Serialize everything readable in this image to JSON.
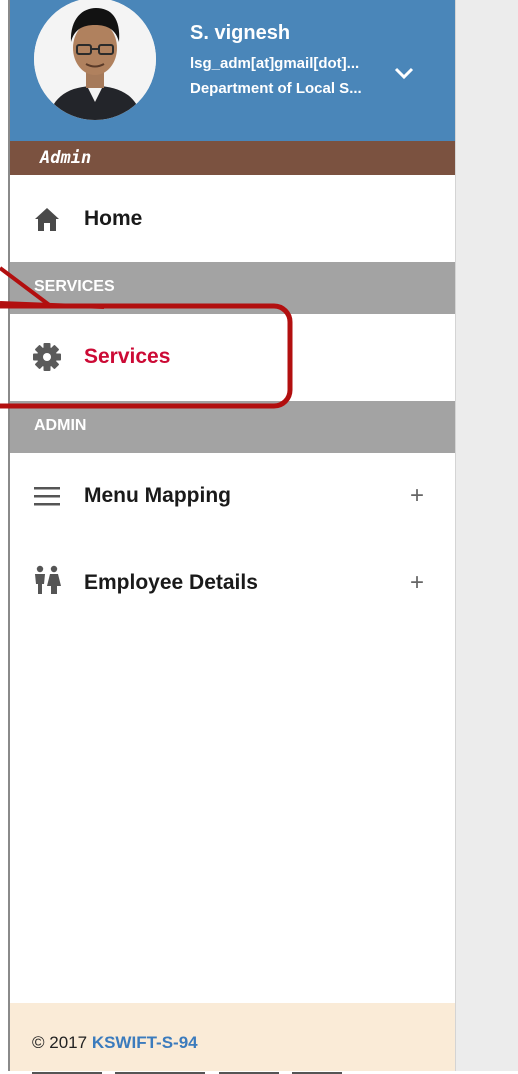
{
  "profile": {
    "name": "S. vignesh",
    "email": "lsg_adm[at]gmail[dot]...",
    "department": "Department of Local S...",
    "avatar_icon": "user-photo",
    "header_color": "#4a86b9"
  },
  "role": {
    "label": "Admin",
    "color": "#7b5240"
  },
  "menu": {
    "home": {
      "label": "Home",
      "icon": "home-icon"
    },
    "services_section": "SERVICES",
    "services": {
      "label": "Services",
      "icon": "gear-icon",
      "color": "#cc0a35"
    },
    "admin_section": "ADMIN",
    "menu_mapping": {
      "label": "Menu Mapping",
      "icon": "hamburger-icon",
      "expand": "+"
    },
    "employee_details": {
      "label": "Employee Details",
      "icon": "people-icon",
      "expand": "+"
    }
  },
  "footer": {
    "copyright": "© 2017",
    "brand": "KSWIFT-S-94",
    "background": "#faebd7"
  },
  "annotation": {
    "color": "#b20f0f"
  }
}
